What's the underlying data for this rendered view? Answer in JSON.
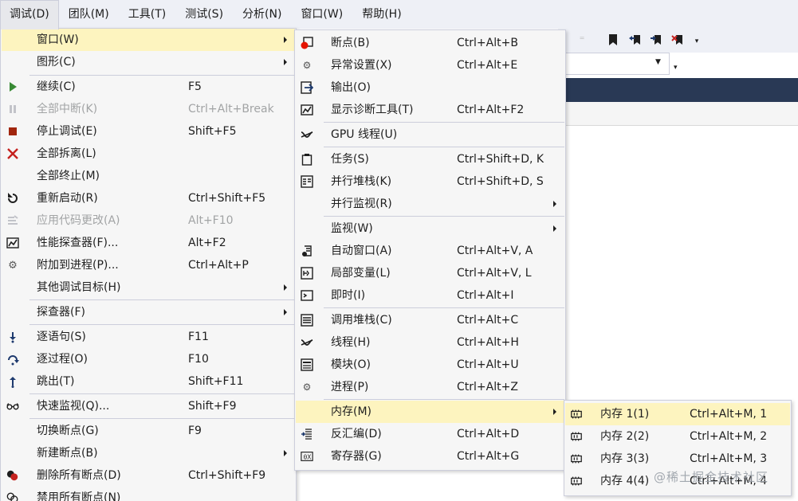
{
  "menubar": [
    {
      "label": "调试(D)",
      "open": true
    },
    {
      "label": "团队(M)"
    },
    {
      "label": "工具(T)"
    },
    {
      "label": "测试(S)"
    },
    {
      "label": "分析(N)"
    },
    {
      "label": "窗口(W)"
    },
    {
      "label": "帮助(H)"
    }
  ],
  "debug_menu": [
    {
      "label": "窗口(W)",
      "submenu": true,
      "highlight": true
    },
    {
      "label": "图形(C)",
      "submenu": true
    },
    {
      "label": "继续(C)",
      "shortcut": "F5",
      "icon": "play-icon"
    },
    {
      "label": "全部中断(K)",
      "shortcut": "Ctrl+Alt+Break",
      "disabled": true,
      "icon": "pause-icon"
    },
    {
      "label": "停止调试(E)",
      "shortcut": "Shift+F5",
      "icon": "stop-icon"
    },
    {
      "label": "全部拆离(L)",
      "icon": "detach-icon"
    },
    {
      "label": "全部终止(M)"
    },
    {
      "label": "重新启动(R)",
      "shortcut": "Ctrl+Shift+F5",
      "icon": "restart-icon"
    },
    {
      "label": "应用代码更改(A)",
      "shortcut": "Alt+F10",
      "disabled": true,
      "icon": "apply-code-icon"
    },
    {
      "label": "性能探查器(F)...",
      "shortcut": "Alt+F2",
      "icon": "profiler-icon"
    },
    {
      "label": "附加到进程(P)...",
      "shortcut": "Ctrl+Alt+P",
      "icon": "attach-gear-icon"
    },
    {
      "label": "其他调试目标(H)",
      "submenu": true
    },
    {
      "label": "探查器(F)",
      "submenu": true
    },
    {
      "label": "逐语句(S)",
      "shortcut": "F11",
      "icon": "step-into-icon"
    },
    {
      "label": "逐过程(O)",
      "shortcut": "F10",
      "icon": "step-over-icon"
    },
    {
      "label": "跳出(T)",
      "shortcut": "Shift+F11",
      "icon": "step-out-icon"
    },
    {
      "label": "快速监视(Q)...",
      "shortcut": "Shift+F9",
      "icon": "glasses-icon"
    },
    {
      "label": "切换断点(G)",
      "shortcut": "F9"
    },
    {
      "label": "新建断点(B)",
      "submenu": true
    },
    {
      "label": "删除所有断点(D)",
      "shortcut": "Ctrl+Shift+F9",
      "icon": "delete-breakpoints-icon"
    },
    {
      "label": "禁用所有断点(N)",
      "icon": "disable-breakpoints-icon"
    }
  ],
  "window_menu": [
    {
      "label": "断点(B)",
      "shortcut": "Ctrl+Alt+B",
      "icon": "breakpoints-icon"
    },
    {
      "label": "异常设置(X)",
      "shortcut": "Ctrl+Alt+E",
      "icon": "exception-settings-icon"
    },
    {
      "label": "输出(O)",
      "icon": "output-icon"
    },
    {
      "label": "显示诊断工具(T)",
      "shortcut": "Ctrl+Alt+F2",
      "icon": "diagnostics-icon"
    },
    {
      "label": "GPU 线程(U)",
      "icon": "gpu-threads-icon"
    },
    {
      "label": "任务(S)",
      "shortcut": "Ctrl+Shift+D, K",
      "icon": "tasks-icon"
    },
    {
      "label": "并行堆栈(K)",
      "shortcut": "Ctrl+Shift+D, S",
      "icon": "parallel-stacks-icon"
    },
    {
      "label": "并行监视(R)",
      "submenu": true
    },
    {
      "label": "监视(W)",
      "submenu": true
    },
    {
      "label": "自动窗口(A)",
      "shortcut": "Ctrl+Alt+V, A",
      "icon": "autos-icon"
    },
    {
      "label": "局部变量(L)",
      "shortcut": "Ctrl+Alt+V, L",
      "icon": "locals-icon"
    },
    {
      "label": "即时(I)",
      "shortcut": "Ctrl+Alt+I",
      "icon": "immediate-icon"
    },
    {
      "label": "调用堆栈(C)",
      "shortcut": "Ctrl+Alt+C",
      "icon": "call-stack-icon"
    },
    {
      "label": "线程(H)",
      "shortcut": "Ctrl+Alt+H",
      "icon": "threads-icon"
    },
    {
      "label": "模块(O)",
      "shortcut": "Ctrl+Alt+U",
      "icon": "modules-icon"
    },
    {
      "label": "进程(P)",
      "shortcut": "Ctrl+Alt+Z",
      "icon": "processes-icon"
    },
    {
      "label": "内存(M)",
      "submenu": true,
      "highlight": true
    },
    {
      "label": "反汇编(D)",
      "shortcut": "Ctrl+Alt+D",
      "icon": "disassembly-icon"
    },
    {
      "label": "寄存器(G)",
      "shortcut": "Ctrl+Alt+G",
      "icon": "registers-icon"
    }
  ],
  "memory_menu": [
    {
      "label": "内存 1(1)",
      "shortcut": "Ctrl+Alt+M, 1",
      "icon": "memory-icon",
      "highlight": true
    },
    {
      "label": "内存 2(2)",
      "shortcut": "Ctrl+Alt+M, 2",
      "icon": "memory-icon"
    },
    {
      "label": "内存 3(3)",
      "shortcut": "Ctrl+Alt+M, 3",
      "icon": "memory-icon"
    },
    {
      "label": "内存 4(4)",
      "shortcut": "Ctrl+Alt+M, 4",
      "icon": "memory-icon"
    }
  ],
  "watermark": "@稀土掘金技术社区",
  "colors": {
    "menubar_bg": "#eef0f6",
    "menu_bg": "#f6f6f6",
    "highlight": "#fdf4bf",
    "disabled_text": "#a2a4a5",
    "dark_band": "#293955",
    "play_green": "#388a34",
    "stop_red": "#a1260d",
    "icon_blue": "#1e3a6e"
  }
}
